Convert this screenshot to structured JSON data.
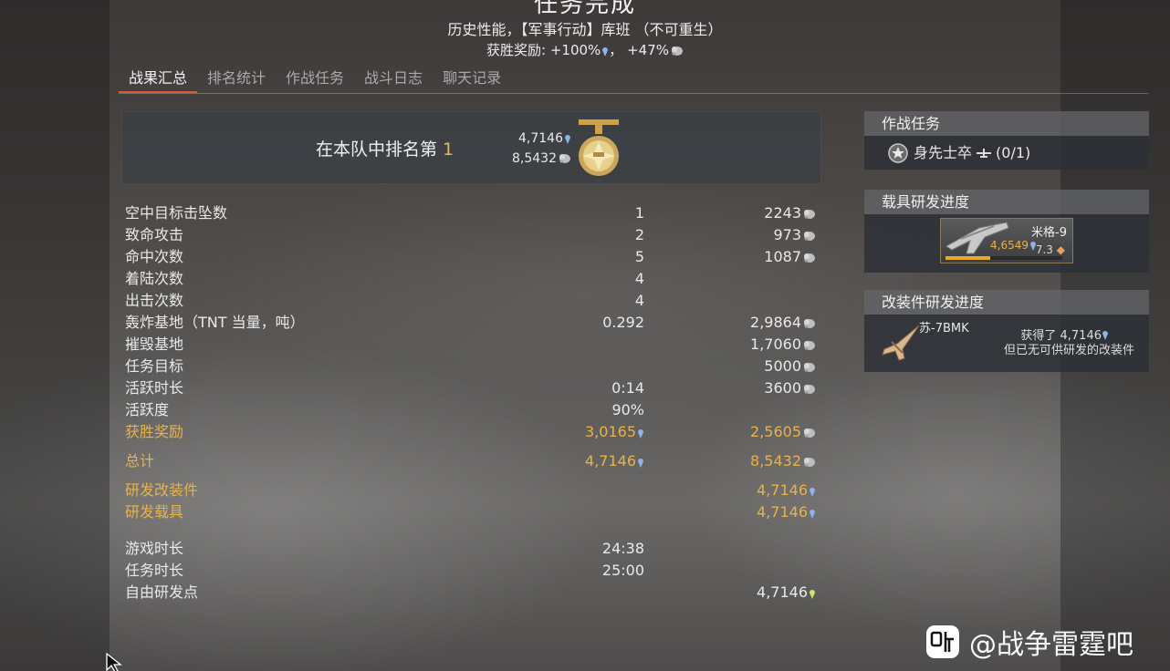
{
  "header": {
    "title": "任务完成",
    "subtitle": "历史性能，【军事行动】库班 （不可重生）",
    "reward_prefix": "获胜奖励:",
    "reward_rp": "+100%",
    "reward_sep": "，",
    "reward_sl": "+47%"
  },
  "tabs": [
    "战果汇总",
    "排名统计",
    "作战任务",
    "战斗日志",
    "聊天记录"
  ],
  "rank": {
    "text": "在本队中排名第",
    "place": "1",
    "rp": "4,7146",
    "sl": "8,5432"
  },
  "stats": [
    {
      "label": "空中目标击坠数",
      "value": "1",
      "sl": "2243"
    },
    {
      "label": "致命攻击",
      "value": "2",
      "sl": "973"
    },
    {
      "label": "命中次数",
      "value": "5",
      "sl": "1087"
    },
    {
      "label": "着陆次数",
      "value": "4",
      "sl": ""
    },
    {
      "label": "出击次数",
      "value": "4",
      "sl": ""
    },
    {
      "label": "轰炸基地（TNT 当量，吨）",
      "value": "0.292",
      "sl": "2,9864"
    },
    {
      "label": "摧毁基地",
      "value": "",
      "sl": "1,7060"
    },
    {
      "label": "任务目标",
      "value": "",
      "sl": "5000"
    },
    {
      "label": "活跃时长",
      "value": "0:14",
      "sl": "3600"
    },
    {
      "label": "活跃度",
      "value": "90%",
      "sl": ""
    }
  ],
  "win_reward": {
    "label": "获胜奖励",
    "rp": "3,0165",
    "sl": "2,5605"
  },
  "total": {
    "label": "总计",
    "rp": "4,7146",
    "sl": "8,5432"
  },
  "research": {
    "mods_label": "研发改装件",
    "mods_rp": "4,7146",
    "vehicle_label": "研发载具",
    "vehicle_rp": "4,7146"
  },
  "times": {
    "game_label": "游戏时长",
    "game_value": "24:38",
    "mission_label": "任务时长",
    "mission_value": "25:00",
    "free_label": "自由研发点",
    "free_value": "4,7146"
  },
  "side": {
    "tasks_title": "作战任务",
    "task_name": "身先士卒",
    "task_progress": "(0/1)",
    "vehicle_title": "载具研发进度",
    "vehicle_name": "米格-9",
    "vehicle_rp": "4,6549",
    "vehicle_br": "7.3",
    "vehicle_progress": 0.38,
    "mods_title": "改装件研发进度",
    "mod_vehicle": "苏-7BMK",
    "mod_msg1": "获得了 4,7146",
    "mod_msg2": "但已无可供研发的改装件"
  },
  "colors": {
    "accent": "#d65a2a",
    "gold": "#e8b24a",
    "rp_blue": "#8fb3e6",
    "free_rp": "#c8e86a"
  },
  "icons": [
    "research-point-icon",
    "silver-lion-icon",
    "medal-icon",
    "star-badge-icon",
    "plane-icon",
    "free-rp-icon"
  ],
  "watermark": "@战争雷霆吧"
}
